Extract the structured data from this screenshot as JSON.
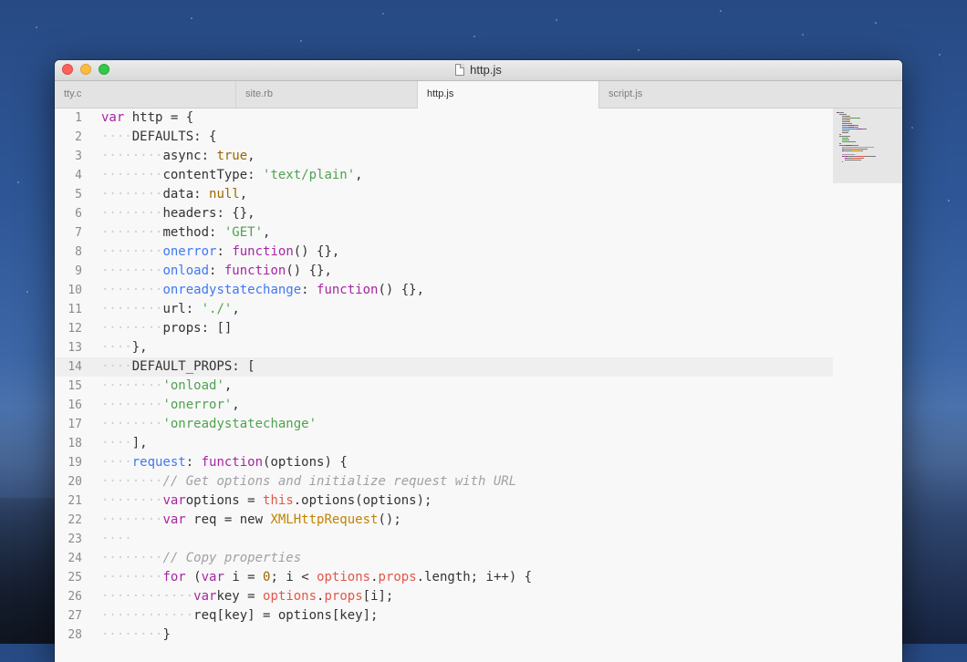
{
  "window": {
    "title": "http.js"
  },
  "tabs": [
    {
      "label": "tty.c",
      "active": false
    },
    {
      "label": "site.rb",
      "active": false
    },
    {
      "label": "http.js",
      "active": true
    },
    {
      "label": "script.js",
      "active": false
    }
  ],
  "editor": {
    "highlighted_line": 14,
    "lines": [
      {
        "n": "1",
        "i": 0,
        "t": [
          [
            "kw",
            "var"
          ],
          [
            "",
            "http = {"
          ]
        ]
      },
      {
        "n": "2",
        "i": 1,
        "t": [
          [
            "",
            "DEFAULTS: {"
          ]
        ]
      },
      {
        "n": "3",
        "i": 2,
        "t": [
          [
            "",
            "async: "
          ],
          [
            "bool",
            "true"
          ],
          [
            "",
            ","
          ]
        ]
      },
      {
        "n": "4",
        "i": 2,
        "t": [
          [
            "",
            "contentType: "
          ],
          [
            "str",
            "'text/plain'"
          ],
          [
            "",
            ","
          ]
        ]
      },
      {
        "n": "5",
        "i": 2,
        "t": [
          [
            "",
            "data: "
          ],
          [
            "bool",
            "null"
          ],
          [
            "",
            ","
          ]
        ]
      },
      {
        "n": "6",
        "i": 2,
        "t": [
          [
            "",
            "headers: {},"
          ]
        ]
      },
      {
        "n": "7",
        "i": 2,
        "t": [
          [
            "",
            "method: "
          ],
          [
            "str",
            "'GET'"
          ],
          [
            "",
            ","
          ]
        ]
      },
      {
        "n": "8",
        "i": 2,
        "t": [
          [
            "prop",
            "onerror"
          ],
          [
            "",
            ": "
          ],
          [
            "kw",
            "function"
          ],
          [
            "",
            "() {},"
          ]
        ]
      },
      {
        "n": "9",
        "i": 2,
        "t": [
          [
            "prop",
            "onload"
          ],
          [
            "",
            ": "
          ],
          [
            "kw",
            "function"
          ],
          [
            "",
            "() {},"
          ]
        ]
      },
      {
        "n": "10",
        "i": 2,
        "t": [
          [
            "prop",
            "onreadystatechange"
          ],
          [
            "",
            ": "
          ],
          [
            "kw",
            "function"
          ],
          [
            "",
            "() {},"
          ]
        ]
      },
      {
        "n": "11",
        "i": 2,
        "t": [
          [
            "",
            "url: "
          ],
          [
            "str",
            "'./'"
          ],
          [
            "",
            ","
          ]
        ]
      },
      {
        "n": "12",
        "i": 2,
        "t": [
          [
            "",
            "props: []"
          ]
        ]
      },
      {
        "n": "13",
        "i": 1,
        "t": [
          [
            "",
            "},"
          ]
        ]
      },
      {
        "n": "14",
        "i": 1,
        "t": [
          [
            "",
            "DEFAULT_PROPS: ["
          ]
        ]
      },
      {
        "n": "15",
        "i": 2,
        "t": [
          [
            "str",
            "'onload'"
          ],
          [
            "",
            ","
          ]
        ]
      },
      {
        "n": "16",
        "i": 2,
        "t": [
          [
            "str",
            "'onerror'"
          ],
          [
            "",
            ","
          ]
        ]
      },
      {
        "n": "17",
        "i": 2,
        "t": [
          [
            "str",
            "'onreadystatechange'"
          ]
        ]
      },
      {
        "n": "18",
        "i": 1,
        "t": [
          [
            "",
            "],"
          ]
        ]
      },
      {
        "n": "19",
        "i": 1,
        "t": [
          [
            "prop",
            "request"
          ],
          [
            "",
            ": "
          ],
          [
            "kw",
            "function"
          ],
          [
            "",
            "(options) {"
          ]
        ]
      },
      {
        "n": "20",
        "i": 2,
        "t": [
          [
            "cmt",
            "// Get options and initialize request with URL"
          ]
        ]
      },
      {
        "n": "21",
        "i": 2,
        "t": [
          [
            "kw",
            "var"
          ],
          [
            "",
            ""
          ],
          [
            "",
            "options = "
          ],
          [
            "this",
            "this"
          ],
          [
            "",
            ".options(options);"
          ]
        ]
      },
      {
        "n": "22",
        "i": 2,
        "t": [
          [
            "kw",
            "var"
          ],
          [
            "",
            "req = new "
          ],
          [
            "cls",
            "XMLHttpRequest"
          ],
          [
            "",
            "();"
          ]
        ]
      },
      {
        "n": "23",
        "i": 1,
        "t": []
      },
      {
        "n": "24",
        "i": 2,
        "t": [
          [
            "cmt",
            "// Copy properties"
          ]
        ]
      },
      {
        "n": "25",
        "i": 2,
        "t": [
          [
            "kw",
            "for"
          ],
          [
            "",
            " ("
          ],
          [
            "kw",
            "var"
          ],
          [
            "",
            " i = "
          ],
          [
            "num",
            "0"
          ],
          [
            "",
            "; i < "
          ],
          [
            "this",
            "options"
          ],
          [
            "",
            "."
          ],
          [
            "this",
            "props"
          ],
          [
            "",
            ".length; i++) {"
          ]
        ]
      },
      {
        "n": "26",
        "i": 3,
        "t": [
          [
            "kw",
            "var"
          ],
          [
            "",
            ""
          ],
          [
            "",
            "key = "
          ],
          [
            "this",
            "options"
          ],
          [
            "",
            "."
          ],
          [
            "this",
            "props"
          ],
          [
            "",
            "[i];"
          ]
        ]
      },
      {
        "n": "27",
        "i": 3,
        "t": [
          [
            "",
            "req[key] = options[key];"
          ]
        ]
      },
      {
        "n": "28",
        "i": 2,
        "t": [
          [
            "",
            "}"
          ]
        ]
      }
    ]
  }
}
